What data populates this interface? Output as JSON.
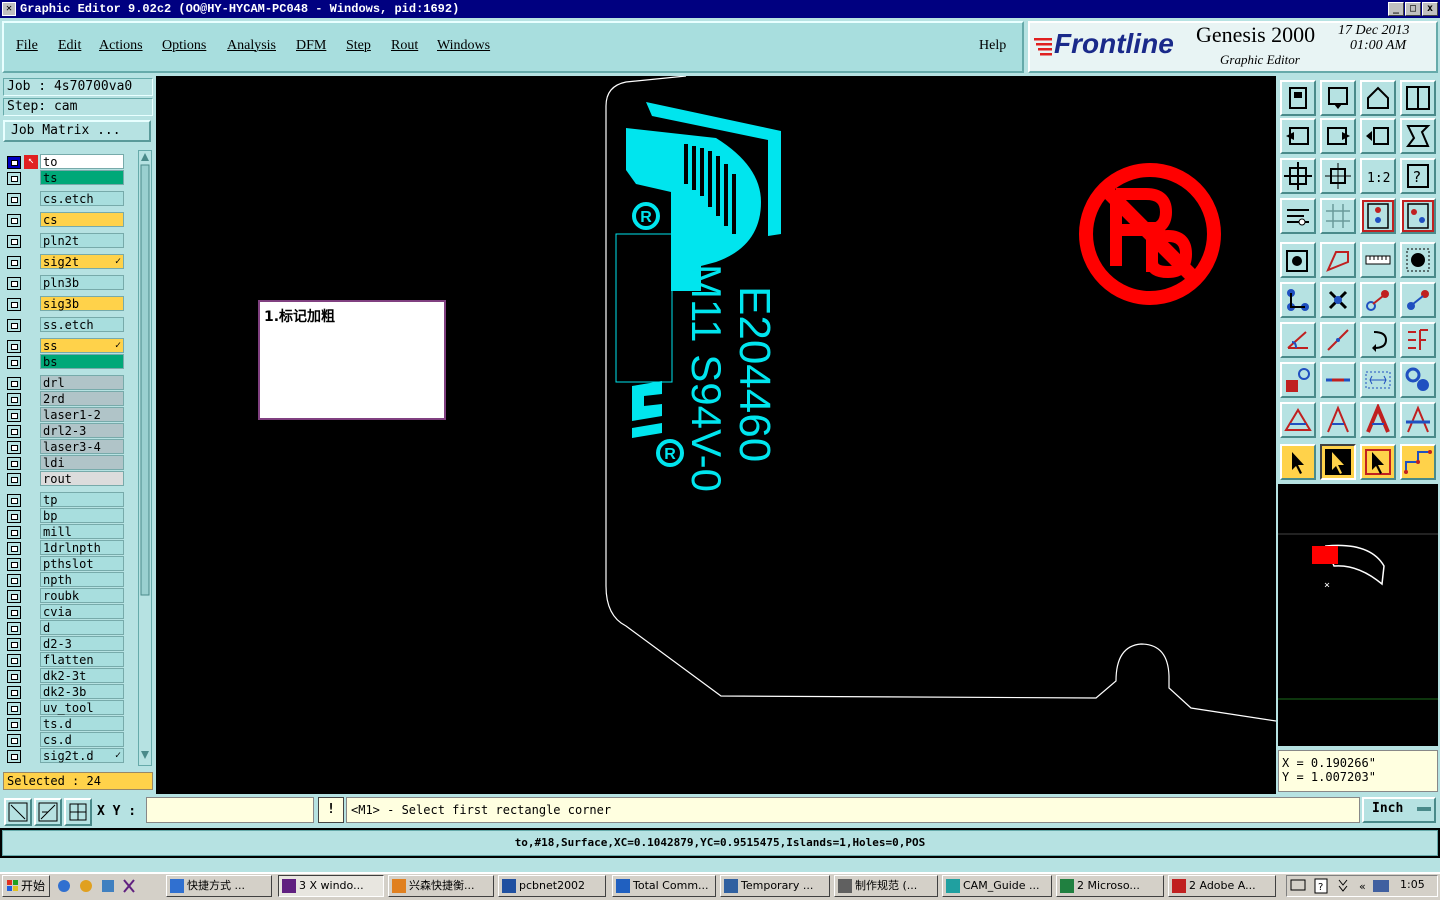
{
  "window": {
    "title": "Graphic Editor 9.02c2  (OO@HY-HYCAM-PC048 - Windows, pid:1692)",
    "controls": [
      "_",
      "□",
      "x"
    ]
  },
  "menu": [
    "File",
    "Edit",
    "Actions",
    "Options",
    "Analysis",
    "DFM",
    "Step",
    "Rout",
    "Windows"
  ],
  "help": "Help",
  "brand": {
    "logo": "Frontline",
    "product": "Genesis 2000",
    "subtitle": "Graphic Editor",
    "date": "17  Dec  2013",
    "time": "01:00  AM"
  },
  "job": {
    "job_label": "Job : 4s70700va0",
    "step_label": "Step: cam",
    "matrix_button": "Job Matrix ..."
  },
  "layers": [
    {
      "name": "to",
      "color": "#ffffff",
      "active": true
    },
    {
      "name": "ts",
      "color": "#00a878"
    },
    {
      "name": "cs.etch",
      "color": "#a8dede"
    },
    {
      "name": "cs",
      "color": "#ffd24a"
    },
    {
      "name": "pln2t",
      "color": "#a8dede"
    },
    {
      "name": "sig2t",
      "color": "#ffd24a",
      "flag": "✓"
    },
    {
      "name": "pln3b",
      "color": "#a8dede"
    },
    {
      "name": "sig3b",
      "color": "#ffd24a"
    },
    {
      "name": "ss.etch",
      "color": "#a8dede"
    },
    {
      "name": "ss",
      "color": "#ffd24a",
      "flag": "✓"
    },
    {
      "name": "bs",
      "color": "#00a878"
    },
    {
      "name": "drl",
      "color": "#b0c4c8"
    },
    {
      "name": "2rd",
      "color": "#b0c4c8"
    },
    {
      "name": "laser1-2",
      "color": "#b0c4c8"
    },
    {
      "name": "drl2-3",
      "color": "#b0c4c8"
    },
    {
      "name": "laser3-4",
      "color": "#b0c4c8"
    },
    {
      "name": "ldi",
      "color": "#b0c4c8"
    },
    {
      "name": "rout",
      "color": "#dcdcdc"
    },
    {
      "name": "tp",
      "color": "#a8dede"
    },
    {
      "name": "bp",
      "color": "#a8dede"
    },
    {
      "name": "mill",
      "color": "#a8dede"
    },
    {
      "name": "1drlnpth",
      "color": "#a8dede"
    },
    {
      "name": "pthslot",
      "color": "#a8dede"
    },
    {
      "name": "npth",
      "color": "#a8dede"
    },
    {
      "name": "roubk",
      "color": "#a8dede"
    },
    {
      "name": "cvia",
      "color": "#a8dede"
    },
    {
      "name": "d",
      "color": "#a8dede"
    },
    {
      "name": "d2-3",
      "color": "#a8dede"
    },
    {
      "name": "flatten",
      "color": "#a8dede"
    },
    {
      "name": "dk2-3t",
      "color": "#a8dede"
    },
    {
      "name": "dk2-3b",
      "color": "#a8dede"
    },
    {
      "name": "uv_tool",
      "color": "#a8dede"
    },
    {
      "name": "ts.d",
      "color": "#a8dede"
    },
    {
      "name": "cs.d",
      "color": "#a8dede"
    },
    {
      "name": "sig2t.d",
      "color": "#a8dede",
      "flag": "✓"
    }
  ],
  "selected": "Selected : 24",
  "note": "1.标记加粗",
  "board_text": {
    "line1": "E204460",
    "line2": "M11 S94V-0",
    "mark": "R"
  },
  "coords": {
    "x": "X  =  0.190266\"",
    "y": "Y  =  1.007203\""
  },
  "command": {
    "xy_label": "X Y :",
    "xy_value": "",
    "prompt_flag": "!",
    "prompt": "<M1> - Select first rectangle corner",
    "units": "Inch"
  },
  "status": "to,#18,Surface,XC=0.1042879,YC=0.9515475,Islands=1,Holes=0,POS",
  "taskbar": {
    "start": "开始",
    "tasks": [
      "快捷方式 ...",
      "3 X windo...",
      "兴森快捷衡...",
      "pcbnet2002",
      "Total Comm...",
      "Temporary ...",
      "制作规范 (...",
      "CAM_Guide ...",
      "2 Microso...",
      "2 Adobe A..."
    ],
    "clock": "1:05"
  },
  "colors": {
    "panel": "#b6e2e2",
    "feature": "#00e5ee",
    "outline": "#ffffff",
    "nopb": "#ff0000",
    "highlight": "#ffd24a"
  }
}
